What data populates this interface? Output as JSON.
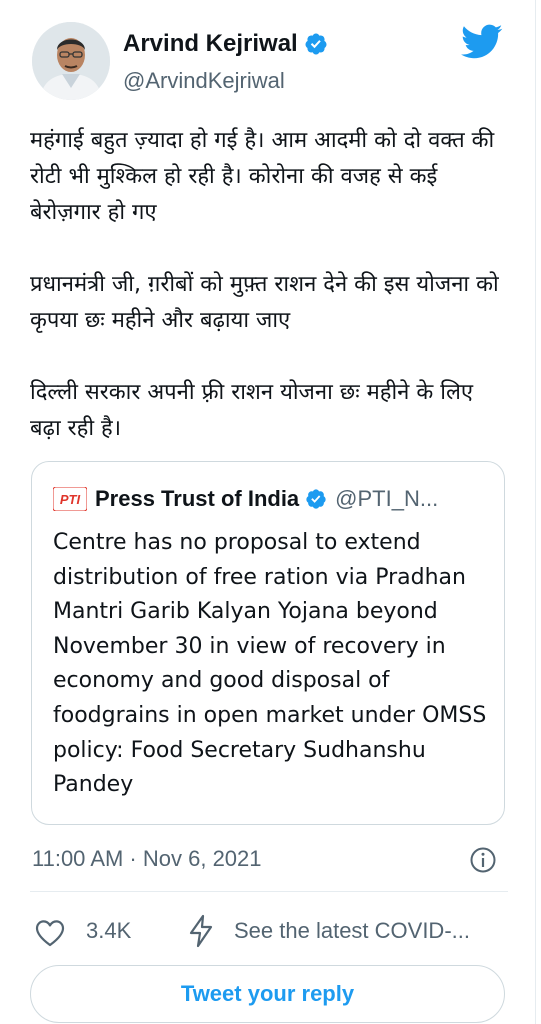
{
  "author": {
    "name": "Arvind Kejriwal",
    "handle": "@ArvindKejriwal"
  },
  "tweet": {
    "paragraphs": [
      "महंगाई बहुत ज़्यादा हो गई है। आम आदमी को दो वक्त की रोटी भी मुश्किल हो रही है। कोरोना की वजह से कई बेरोज़गार हो गए",
      "प्रधानमंत्री जी, ग़रीबों को मुफ़्त राशन देने की इस योजना को कृपया छः महीने और बढ़ाया जाए",
      "दिल्ली सरकार अपनी फ़्री राशन योजना छः महीने के लिए बढ़ा रही है।"
    ]
  },
  "quote": {
    "logo_text": "PTI",
    "name": "Press Trust of India",
    "handle": "@PTI_N...",
    "text": "Centre has no proposal to extend distribution of free ration via Pradhan Mantri Garib Kalyan Yojana beyond November 30 in view of recovery in economy and good disposal of foodgrains in open market under OMSS policy: Food Secretary Sudhanshu Pandey"
  },
  "meta": {
    "timestamp": "11:00 AM · Nov 6, 2021"
  },
  "actions": {
    "like_count": "3.4K",
    "covid_link": "See the latest COVID-..."
  },
  "reply": {
    "label": "Tweet your reply"
  },
  "colors": {
    "accent": "#1d9bf0",
    "secondary_text": "#536471",
    "border": "#cfd9de",
    "pti_red": "#e0352b"
  },
  "icons": [
    "verified-badge-icon",
    "twitter-bird-icon",
    "info-icon",
    "heart-icon",
    "bolt-icon"
  ]
}
